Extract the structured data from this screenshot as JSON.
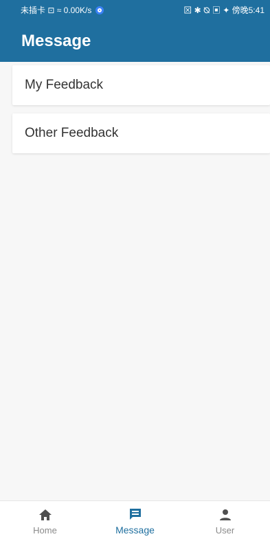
{
  "status_bar": {
    "left": "未插卡 ⊡ ≈ 0.00K/s",
    "right": "⊠ ✱ ⦰ ▣ ✦ 傍晚5:41"
  },
  "header": {
    "title": "Message"
  },
  "feedback_list": [
    {
      "label": "My Feedback"
    },
    {
      "label": "Other Feedback"
    }
  ],
  "bottom_nav": [
    {
      "label": "Home",
      "icon": "home-icon",
      "active": false
    },
    {
      "label": "Message",
      "icon": "message-icon",
      "active": true
    },
    {
      "label": "User",
      "icon": "user-icon",
      "active": false
    }
  ],
  "colors": {
    "primary": "#1f6f9f",
    "background": "#f7f7f7",
    "inactive": "#8a8a8a"
  }
}
